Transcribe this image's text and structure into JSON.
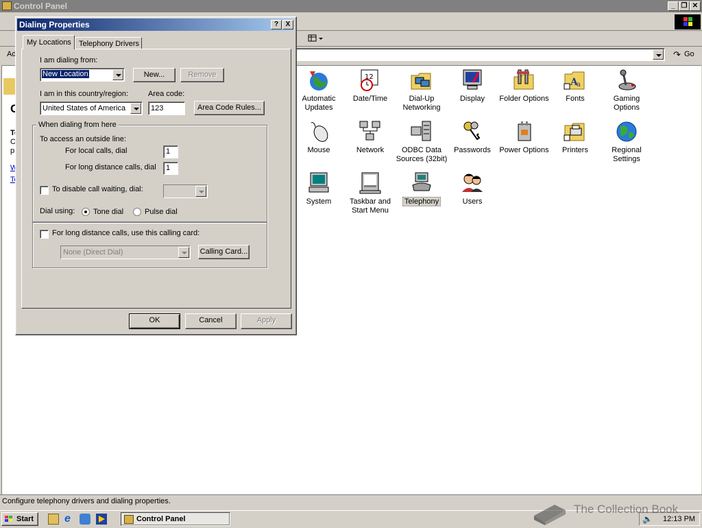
{
  "main_window": {
    "title": "Control Panel",
    "address_label": "Ad",
    "go_label": "Go",
    "status_text": "Configure telephony drivers and dialing properties.",
    "left_panel": {
      "heading_char": "C",
      "text_chars": [
        "Te",
        "Co",
        "pr"
      ],
      "link_chars": [
        "W",
        "Te"
      ]
    }
  },
  "icons": [
    {
      "label": "Automatic Updates",
      "icon": "globe-update-icon"
    },
    {
      "label": "Date/Time",
      "icon": "calendar-clock-icon"
    },
    {
      "label": "Dial-Up Networking",
      "icon": "dialup-folder-icon"
    },
    {
      "label": "Display",
      "icon": "monitor-icon"
    },
    {
      "label": "Folder Options",
      "icon": "folder-options-icon"
    },
    {
      "label": "Fonts",
      "icon": "fonts-folder-icon"
    },
    {
      "label": "Gaming Options",
      "icon": "joystick-icon"
    },
    {
      "label": "Mouse",
      "icon": "mouse-icon"
    },
    {
      "label": "Network",
      "icon": "network-icon"
    },
    {
      "label": "ODBC Data Sources (32bit)",
      "icon": "database-icon"
    },
    {
      "label": "Passwords",
      "icon": "keys-icon"
    },
    {
      "label": "Power Options",
      "icon": "power-plug-icon"
    },
    {
      "label": "Printers",
      "icon": "printer-folder-icon"
    },
    {
      "label": "Regional Settings",
      "icon": "globe-icon"
    },
    {
      "label": "System",
      "icon": "computer-icon"
    },
    {
      "label": "Taskbar and Start Menu",
      "icon": "taskbar-icon"
    },
    {
      "label": "Telephony",
      "icon": "telephone-icon"
    },
    {
      "label": "Users",
      "icon": "users-icon"
    }
  ],
  "dialog": {
    "title": "Dialing Properties",
    "help_btn": "?",
    "close_btn": "X",
    "tabs": [
      "My Locations",
      "Telephony Drivers"
    ],
    "dialing_from_label": "I am dialing from:",
    "location_value": "New Location",
    "new_btn": "New...",
    "remove_btn": "Remove",
    "country_label": "I am in this country/region:",
    "country_value": "United States of America",
    "area_code_label": "Area code:",
    "area_code_value": "123",
    "area_rules_btn": "Area Code Rules...",
    "group_title": "When dialing from here",
    "outside_line_label": "To access an outside line:",
    "local_calls_label": "For local calls, dial",
    "local_calls_value": "1",
    "long_distance_label": "For long distance calls, dial",
    "long_distance_value": "1",
    "call_waiting_label": "To disable call waiting, dial:",
    "dial_using_label": "Dial using:",
    "tone_label": "Tone dial",
    "pulse_label": "Pulse dial",
    "calling_card_label": "For long distance calls, use this calling card:",
    "calling_card_value": "None (Direct Dial)",
    "calling_card_btn": "Calling Card...",
    "ok_btn": "OK",
    "cancel_btn": "Cancel",
    "apply_btn": "Apply"
  },
  "taskbar": {
    "start_label": "Start",
    "task_label": "Control Panel",
    "clock": "12:13 PM"
  },
  "watermark": "The Collection Book"
}
